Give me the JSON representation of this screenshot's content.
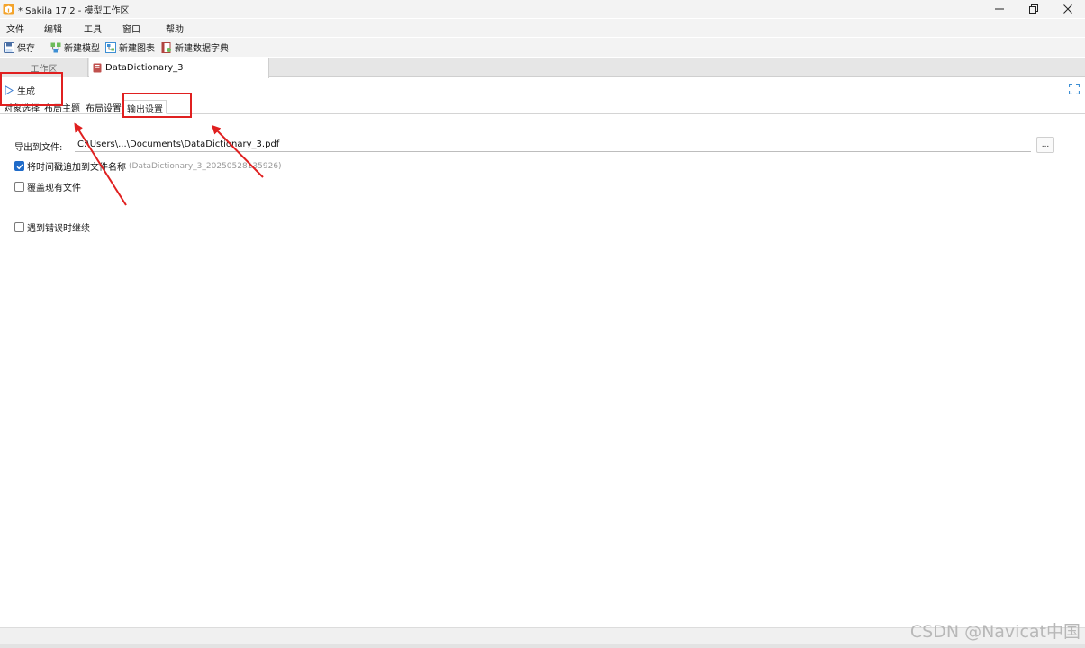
{
  "window": {
    "title": "* Sakila 17.2 - 模型工作区",
    "controls": {
      "minimize": "—",
      "restore": "❐",
      "close": "✕"
    }
  },
  "menu": [
    "文件",
    "编辑",
    "工具",
    "窗口",
    "帮助"
  ],
  "toolbar": {
    "save": "保存",
    "new_model": "新建模型",
    "new_diagram": "新建图表",
    "new_dictionary": "新建数据字典"
  },
  "tabs": {
    "workspace": "工作区",
    "dictionary": "DataDictionary_3"
  },
  "editor": {
    "generate": "生成",
    "subtabs": [
      "对象选择",
      "布局主题",
      "布局设置",
      "输出设置"
    ],
    "active_subtab": "输出设置"
  },
  "output": {
    "export_label": "导出到文件:",
    "export_path": "C:\\Users\\...\\Documents\\DataDictionary_3.pdf",
    "browse": "...",
    "append_timestamp": {
      "label": "将时间戳追加到文件名称",
      "checked": true,
      "hint": "(DataDictionary_3_20250528135926)"
    },
    "overwrite": {
      "label": "覆盖现有文件",
      "checked": false
    },
    "continue_on_error": {
      "label": "遇到错误时继续",
      "checked": false
    }
  },
  "watermark": "CSDN @Navicat中国",
  "colors": {
    "annotation": "#e02020",
    "accent": "#1f6bc9"
  }
}
